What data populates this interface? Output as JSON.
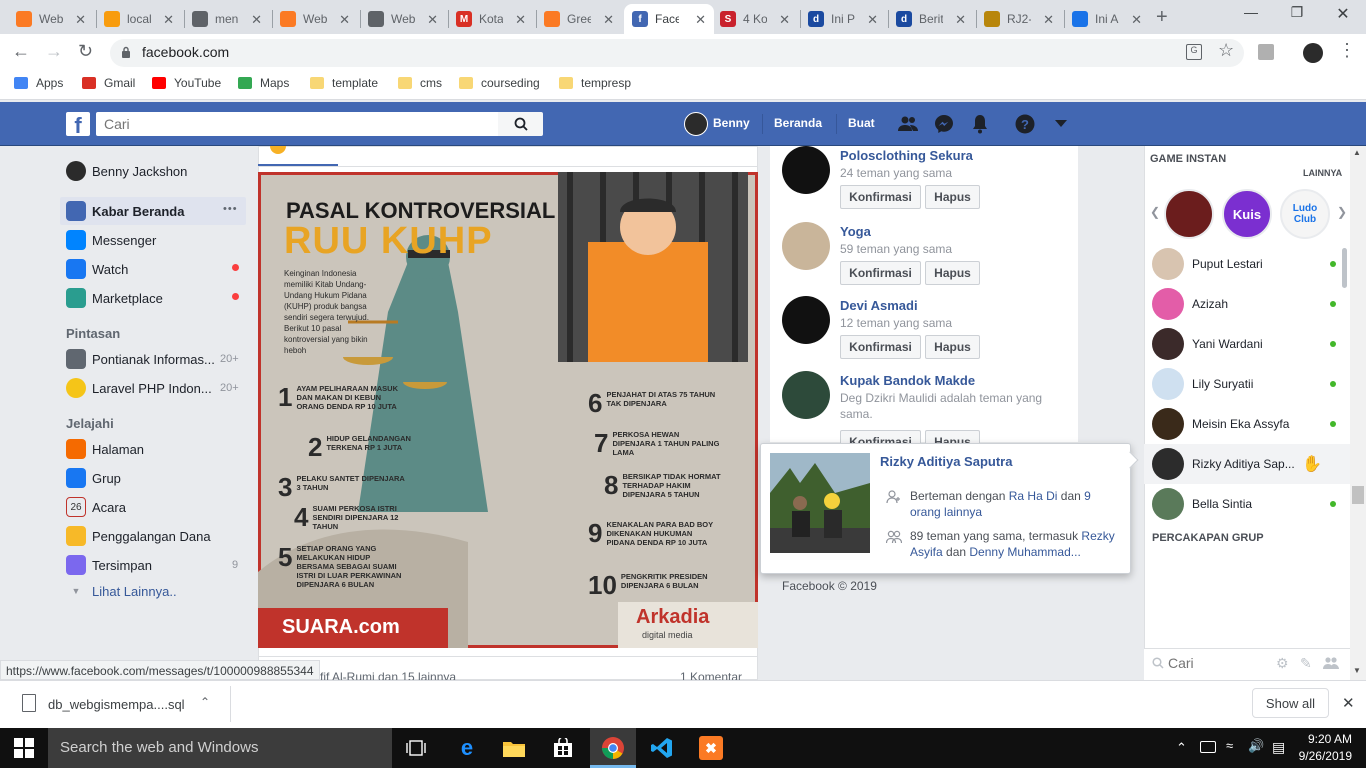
{
  "browser": {
    "tabs": [
      {
        "title": "Web",
        "icon": "xampp-icon",
        "color": "#fb7a24"
      },
      {
        "title": "local",
        "icon": "phpmyadmin-icon",
        "color": "#f89c0e"
      },
      {
        "title": "men",
        "icon": "globe-icon",
        "color": "#5f6368"
      },
      {
        "title": "Web",
        "icon": "xampp-icon",
        "color": "#fb7a24"
      },
      {
        "title": "Web",
        "icon": "globe-icon",
        "color": "#5f6368"
      },
      {
        "title": "Kota",
        "icon": "gmail-icon",
        "color": "#d93025"
      },
      {
        "title": "Gree",
        "icon": "xampp-icon",
        "color": "#fb7a24"
      },
      {
        "title": "Face",
        "icon": "facebook-icon",
        "color": "#4267b2"
      },
      {
        "title": "4 Ko",
        "icon": "s-icon",
        "color": "#c9222d"
      },
      {
        "title": "Ini P",
        "icon": "detik-icon",
        "color": "#1b4aa0"
      },
      {
        "title": "Berit",
        "icon": "detik-icon",
        "color": "#1b4aa0"
      },
      {
        "title": "RJ2-",
        "icon": "emblem-icon",
        "color": "#b8860b"
      },
      {
        "title": "Ini A",
        "icon": "arrow-icon",
        "color": "#1a73e8"
      }
    ],
    "url": "facebook.com",
    "bookmarks": [
      {
        "label": "Apps",
        "icon": "apps-icon"
      },
      {
        "label": "Gmail",
        "icon": "gmail-icon"
      },
      {
        "label": "YouTube",
        "icon": "youtube-icon"
      },
      {
        "label": "Maps",
        "icon": "maps-icon"
      },
      {
        "label": "template",
        "icon": "folder-icon"
      },
      {
        "label": "cms",
        "icon": "folder-icon"
      },
      {
        "label": "courseding",
        "icon": "folder-icon"
      },
      {
        "label": "tempresp",
        "icon": "folder-icon"
      }
    ],
    "status_url": "https://www.facebook.com/messages/t/100000988855344"
  },
  "header": {
    "search_placeholder": "Cari",
    "user_name": "Benny",
    "home": "Beranda",
    "create": "Buat"
  },
  "left": {
    "profile_name": "Benny Jackshon",
    "main_items": [
      {
        "label": "Kabar Beranda",
        "icon": "news-feed-icon"
      },
      {
        "label": "Messenger",
        "icon": "messenger-icon"
      },
      {
        "label": "Watch",
        "icon": "watch-icon"
      },
      {
        "label": "Marketplace",
        "icon": "marketplace-icon"
      }
    ],
    "more_dots": "•••",
    "shortcuts_title": "Pintasan",
    "shortcuts": [
      {
        "label": "Pontianak Informas...",
        "count": "20+"
      },
      {
        "label": "Laravel PHP Indon...",
        "count": "20+"
      }
    ],
    "explore_title": "Jelajahi",
    "explore": [
      {
        "label": "Halaman",
        "icon": "flag-icon",
        "count": ""
      },
      {
        "label": "Grup",
        "icon": "group-icon",
        "count": ""
      },
      {
        "label": "Acara",
        "icon": "calendar-icon",
        "count": ""
      },
      {
        "label": "Penggalangan Dana",
        "icon": "fundraiser-icon",
        "count": ""
      },
      {
        "label": "Tersimpan",
        "icon": "saved-icon",
        "count": "9"
      }
    ],
    "see_more": "Lihat Lainnya.."
  },
  "post": {
    "poster": {
      "title1": "PASAL KONTROVERSIAL",
      "title2": "RUU KUHP",
      "intro": "Keinginan Indonesia memiliki Kitab Undang-Undang Hukum Pidana (KUHP) produk bangsa sendiri segera terwujud. Berikut 10 pasal kontroversial yang bikin heboh",
      "items": [
        {
          "n": "1",
          "text": "AYAM PELIHARAAN MASUK DAN MAKAN DI KEBUN ORANG DENDA RP 10 JUTA"
        },
        {
          "n": "2",
          "text": "HIDUP GELANDANGAN TERKENA RP 1 JUTA"
        },
        {
          "n": "3",
          "text": "PELAKU SANTET DIPENJARA 3 TAHUN"
        },
        {
          "n": "4",
          "text": "SUAMI PERKOSA ISTRI SENDIRI DIPENJARA 12 TAHUN"
        },
        {
          "n": "5",
          "text": "SETIAP ORANG YANG MELAKUKAN HIDUP BERSAMA SEBAGAI SUAMI ISTRI DI LUAR PERKAWINAN DIPENJARA 6 BULAN"
        },
        {
          "n": "6",
          "text": "PENJAHAT DI ATAS 75 TAHUN TAK DIPENJARA"
        },
        {
          "n": "7",
          "text": "PERKOSA HEWAN DIPENJARA 1 TAHUN PALING LAMA"
        },
        {
          "n": "8",
          "text": "BERSIKAP TIDAK HORMAT TERHADAP HAKIM DIPENJARA 5 TAHUN"
        },
        {
          "n": "9",
          "text": "KENAKALAN PARA BAD BOY DIKENAKAN HUKUMAN PIDANA DENDA RP 10 JUTA"
        },
        {
          "n": "10",
          "text": "PENGKRITIK PRESIDEN DIPENJARA 6 BULAN"
        }
      ],
      "source": "SUARA.com",
      "brand": "Arkadia",
      "brand_sub": "digital media"
    },
    "reactions_text": "...fif Al-Rumi dan 15 lainnya",
    "comments": "1 Komentar"
  },
  "requests": [
    {
      "name": "Polosclothing Sekura",
      "mutual": "24 teman yang sama"
    },
    {
      "name": "Yoga",
      "mutual": "59 teman yang sama"
    },
    {
      "name": "Devi Asmadi",
      "mutual": "12 teman yang sama"
    },
    {
      "name": "Kupak Bandok Makde",
      "mutual": "Deg Dzikri Maulidi adalah teman yang sama."
    }
  ],
  "confirm_label": "Konfirmasi",
  "delete_label": "Hapus",
  "copyright": "Facebook © 2019",
  "hovercard": {
    "name": "Rizky Aditiya Saputra",
    "line1_a": "Berteman dengan ",
    "line1_link1": "Ra Ha Di",
    "line1_b": " dan ",
    "line1_link2": "9 orang lainnya",
    "line2_a": "89 teman yang sama, termasuk ",
    "line2_link1": "Rezky Asyifa",
    "line2_b": " dan ",
    "line2_link2": "Denny Muhammad..."
  },
  "chat": {
    "games_title": "GAME INSTAN",
    "games_more": "LAINNYA",
    "games": [
      "Kuis",
      "Ludo Club"
    ],
    "contacts": [
      {
        "name": "Puput Lestari",
        "online": true
      },
      {
        "name": "Azizah",
        "online": true
      },
      {
        "name": "Yani Wardani",
        "online": true
      },
      {
        "name": "Lily Suryatii",
        "online": true
      },
      {
        "name": "Meisin Eka Assyfa",
        "online": true
      },
      {
        "name": "Rizky Aditiya Sap...",
        "online": false
      },
      {
        "name": "Bella Sintia",
        "online": true
      }
    ],
    "groups_title": "PERCAKAPAN GRUP",
    "search_placeholder": "Cari"
  },
  "download": {
    "file": "db_webgismempa....sql",
    "show_all": "Show all"
  },
  "taskbar": {
    "search": "Search the web and Windows",
    "time": "9:20 AM",
    "date": "9/26/2019"
  },
  "colors": {
    "fb_blue": "#4267b2",
    "link": "#365899",
    "online": "#42b72a"
  }
}
